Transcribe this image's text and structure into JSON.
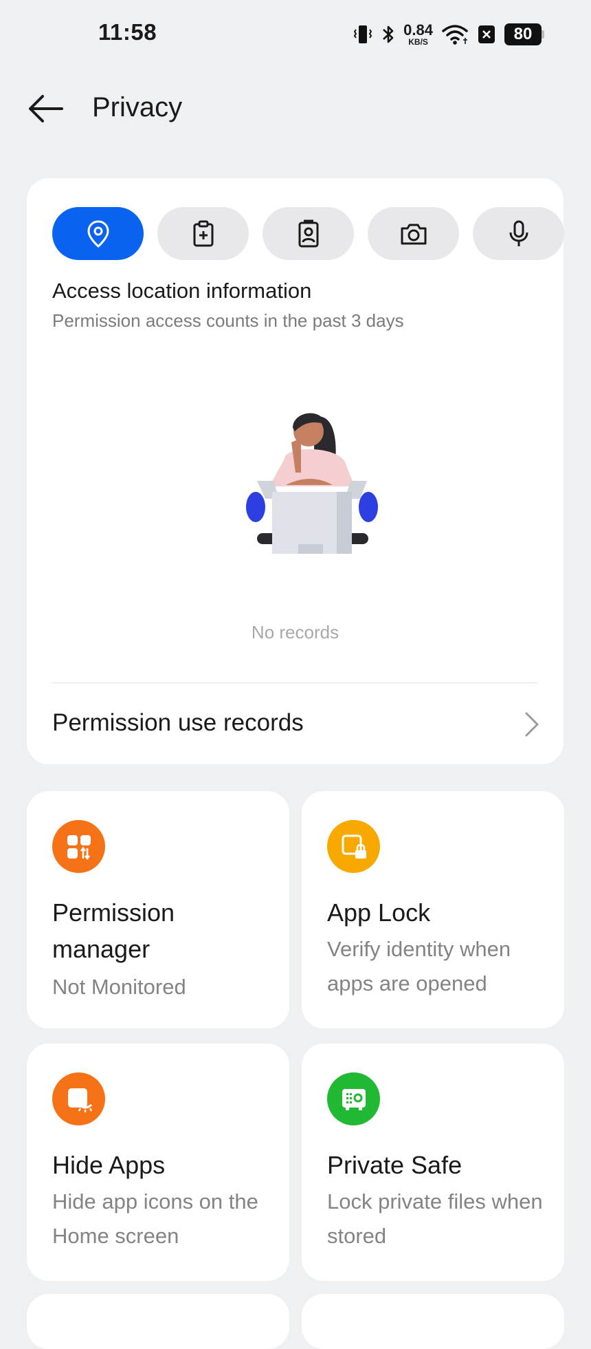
{
  "status_bar": {
    "time": "11:58",
    "net_speed_value": "0.84",
    "net_speed_unit": "KB/S",
    "battery": "80",
    "icons": [
      "vibrate-icon",
      "bluetooth-icon",
      "wifi-icon",
      "nfc-icon",
      "battery-icon"
    ]
  },
  "header": {
    "title": "Privacy",
    "back_icon": "back-arrow-icon"
  },
  "permission_card": {
    "tabs": [
      {
        "name": "location",
        "icon": "location-pin-icon",
        "active": true
      },
      {
        "name": "clipboard",
        "icon": "clipboard-icon",
        "active": false
      },
      {
        "name": "contacts",
        "icon": "contacts-icon",
        "active": false
      },
      {
        "name": "camera",
        "icon": "camera-icon",
        "active": false
      },
      {
        "name": "microphone",
        "icon": "microphone-icon",
        "active": false
      }
    ],
    "title": "Access location information",
    "subtitle": "Permission access counts in the past 3 days",
    "empty_text": "No records",
    "records_link": "Permission use records"
  },
  "tiles": [
    {
      "title": "Permission manager",
      "desc": "Not Monitored",
      "icon": "permission-manager-icon",
      "color": "#f57316"
    },
    {
      "title": "App Lock",
      "desc": "Verify identity when apps are opened",
      "icon": "app-lock-icon",
      "color": "#f7a900"
    },
    {
      "title": "Hide Apps",
      "desc": "Hide app icons on the Home screen",
      "icon": "hide-apps-icon",
      "color": "#f57316"
    },
    {
      "title": "Private Safe",
      "desc": "Lock private files when stored",
      "icon": "private-safe-icon",
      "color": "#21b834"
    }
  ],
  "colors": {
    "accent": "#0a62f0",
    "background": "#eff0f2",
    "card": "#ffffff"
  }
}
